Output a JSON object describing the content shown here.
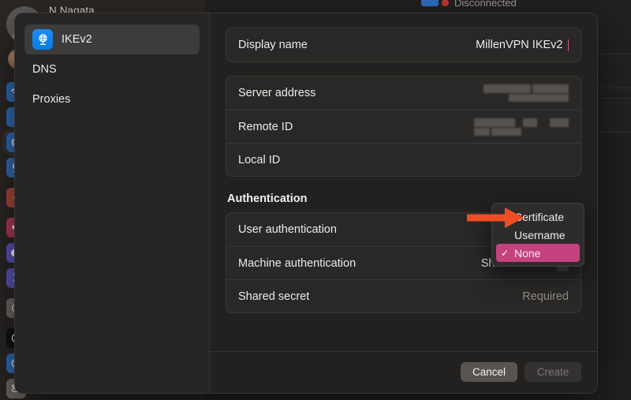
{
  "window": {
    "account_name": "N Nagata",
    "background_status_text": "Disconnected",
    "help_label": "?"
  },
  "rail": {
    "icons": [
      {
        "name": "wifi-icon",
        "glyph": "◑",
        "bg": "#2f6fbe",
        "selected": false
      },
      {
        "name": "bluetooth-icon",
        "glyph": "ᛗ",
        "bg": "#2f6fbe",
        "selected": false
      },
      {
        "name": "network-icon",
        "glyph": "⊕",
        "bg": "#2f6fbe",
        "selected": true
      },
      {
        "name": "vpn-icon",
        "glyph": "⊕",
        "bg": "#2f6fbe",
        "selected": false
      },
      {
        "name": "notifications-icon",
        "glyph": "●",
        "bg": "#b6453f",
        "selected": false
      },
      {
        "name": "sound-icon",
        "glyph": "◀",
        "bg": "#b6395a",
        "selected": false
      },
      {
        "name": "focus-icon",
        "glyph": "☾",
        "bg": "#5d56c2",
        "selected": false
      },
      {
        "name": "screen-time-icon",
        "glyph": "⧗",
        "bg": "#5d56c2",
        "selected": false
      },
      {
        "name": "general-icon",
        "glyph": "⚙",
        "bg": "#6e6b68",
        "selected": false
      },
      {
        "name": "appearance-icon",
        "glyph": "◐",
        "bg": "#131211",
        "selected": false
      },
      {
        "name": "accessibility-icon",
        "glyph": "⚲",
        "bg": "#2f6fbe",
        "selected": false
      },
      {
        "name": "control-center-icon",
        "glyph": "▭",
        "bg": "#6e6b68",
        "selected": false
      }
    ]
  },
  "sheet": {
    "sidebar": {
      "items": [
        {
          "label": "IKEv2",
          "icon": "vpn-globe-icon",
          "selected": true
        },
        {
          "label": "DNS",
          "icon": null,
          "selected": false
        },
        {
          "label": "Proxies",
          "icon": null,
          "selected": false
        }
      ]
    },
    "groups": [
      {
        "name": "display-name-group",
        "rows": [
          {
            "name": "display-name",
            "label": "Display name",
            "value": "MillenVPN IKEv2",
            "kind": "text-editing"
          }
        ]
      },
      {
        "name": "server-group",
        "rows": [
          {
            "name": "server-address",
            "label": "Server address",
            "value": "",
            "kind": "redacted"
          },
          {
            "name": "remote-id",
            "label": "Remote ID",
            "value": "",
            "kind": "redacted"
          },
          {
            "name": "local-id",
            "label": "Local ID",
            "value": "",
            "kind": "empty"
          }
        ]
      }
    ],
    "authentication": {
      "section_title": "Authentication",
      "rows": [
        {
          "name": "user-authentication",
          "label": "User authentication",
          "value": "",
          "kind": "popup-open"
        },
        {
          "name": "machine-authentication",
          "label": "Machine authentication",
          "value": "Shared secret",
          "kind": "popup"
        },
        {
          "name": "shared-secret",
          "label": "Shared secret",
          "value": "Required",
          "kind": "placeholder"
        }
      ]
    },
    "popup_menu": {
      "name": "user-authentication-menu",
      "items": [
        {
          "label": "Certificate",
          "selected": false
        },
        {
          "label": "Username",
          "selected": false
        },
        {
          "label": "None",
          "selected": true
        }
      ],
      "check_glyph": "✓",
      "highlight_color": "#c4437f"
    },
    "footer": {
      "cancel_label": "Cancel",
      "create_label": "Create",
      "create_disabled": true
    }
  },
  "annotation": {
    "arrow_color": "#ef4d26",
    "points_to": "Username"
  }
}
